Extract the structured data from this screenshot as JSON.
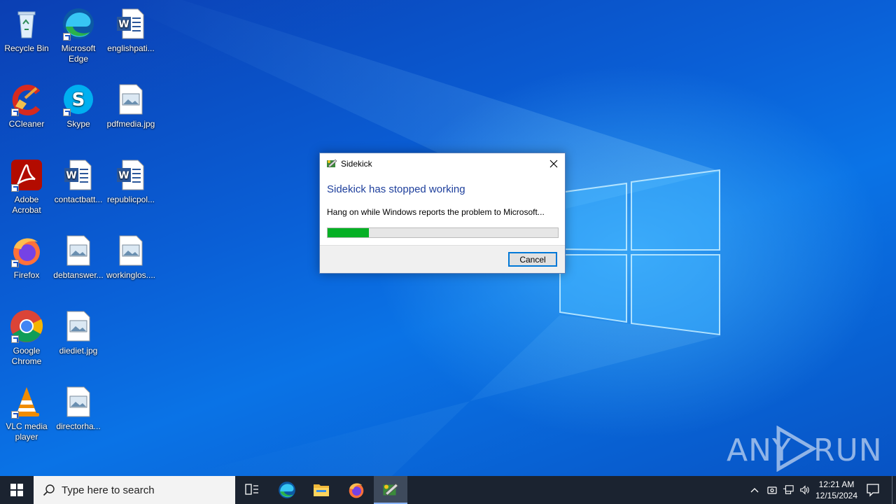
{
  "desktop": {
    "icons": [
      {
        "label": "Recycle Bin"
      },
      {
        "label": "Microsoft Edge"
      },
      {
        "label": "englishpati..."
      },
      {
        "label": "CCleaner"
      },
      {
        "label": "Skype"
      },
      {
        "label": "pdfmedia.jpg"
      },
      {
        "label": "Adobe Acrobat"
      },
      {
        "label": "contactbatt..."
      },
      {
        "label": "republicpol..."
      },
      {
        "label": "Firefox"
      },
      {
        "label": "debtanswer..."
      },
      {
        "label": "workinglos...."
      },
      {
        "label": "Google Chrome"
      },
      {
        "label": "diediet.jpg"
      },
      {
        "label": "VLC media player"
      },
      {
        "label": "directorha..."
      }
    ]
  },
  "dialog": {
    "title": "Sidekick",
    "heading": "Sidekick has stopped working",
    "message": "Hang on while Windows reports the problem to Microsoft...",
    "progress_fraction": 0.18,
    "cancel_label": "Cancel",
    "heading_color": "#1e3f9c",
    "progress_color": "#06b025"
  },
  "taskbar": {
    "search_placeholder": "Type here to search",
    "pinned": [
      "task-view",
      "microsoft-edge",
      "file-explorer",
      "firefox",
      "sidekick"
    ],
    "active": "sidekick",
    "clock_time": "12:21 AM",
    "clock_date": "12/15/2024"
  },
  "watermark": {
    "left": "ANY",
    "right": "RUN"
  }
}
